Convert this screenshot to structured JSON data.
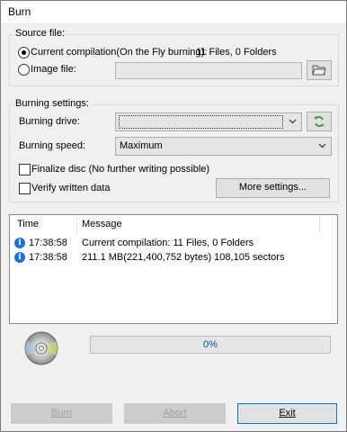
{
  "window": {
    "title": "Burn"
  },
  "source": {
    "group_label": "Source file:",
    "current_label": "Current compilation(On the Fly burning):",
    "current_info": "11 Files, 0 Folders",
    "image_label": "Image file:",
    "image_value": "",
    "browse_icon": "folder-open-icon"
  },
  "settings": {
    "group_label": "Burning settings:",
    "drive_label": "Burning drive:",
    "drive_value": "",
    "refresh_icon": "refresh-icon",
    "speed_label": "Burning speed:",
    "speed_value": "Maximum",
    "finalize_label": "Finalize disc (No further writing possible)",
    "verify_label": "Verify written data",
    "more_label": "More settings..."
  },
  "log": {
    "col_time": "Time",
    "col_message": "Message",
    "rows": [
      {
        "time": "17:38:58",
        "message": "Current compilation: 11 Files, 0 Folders",
        "icon": "info-icon"
      },
      {
        "time": "17:38:58",
        "message": "211.1 MB(221,400,752 bytes)  108,105 sectors",
        "icon": "info-icon"
      }
    ]
  },
  "progress": {
    "value": 0,
    "label": "0%"
  },
  "buttons": {
    "burn_label": "Burn",
    "abort_label": "Abort",
    "exit_label": "Exit"
  },
  "colors": {
    "accent": "#0078d7",
    "info_icon": "#1e6fd9",
    "refresh_icon": "#3da33d"
  }
}
